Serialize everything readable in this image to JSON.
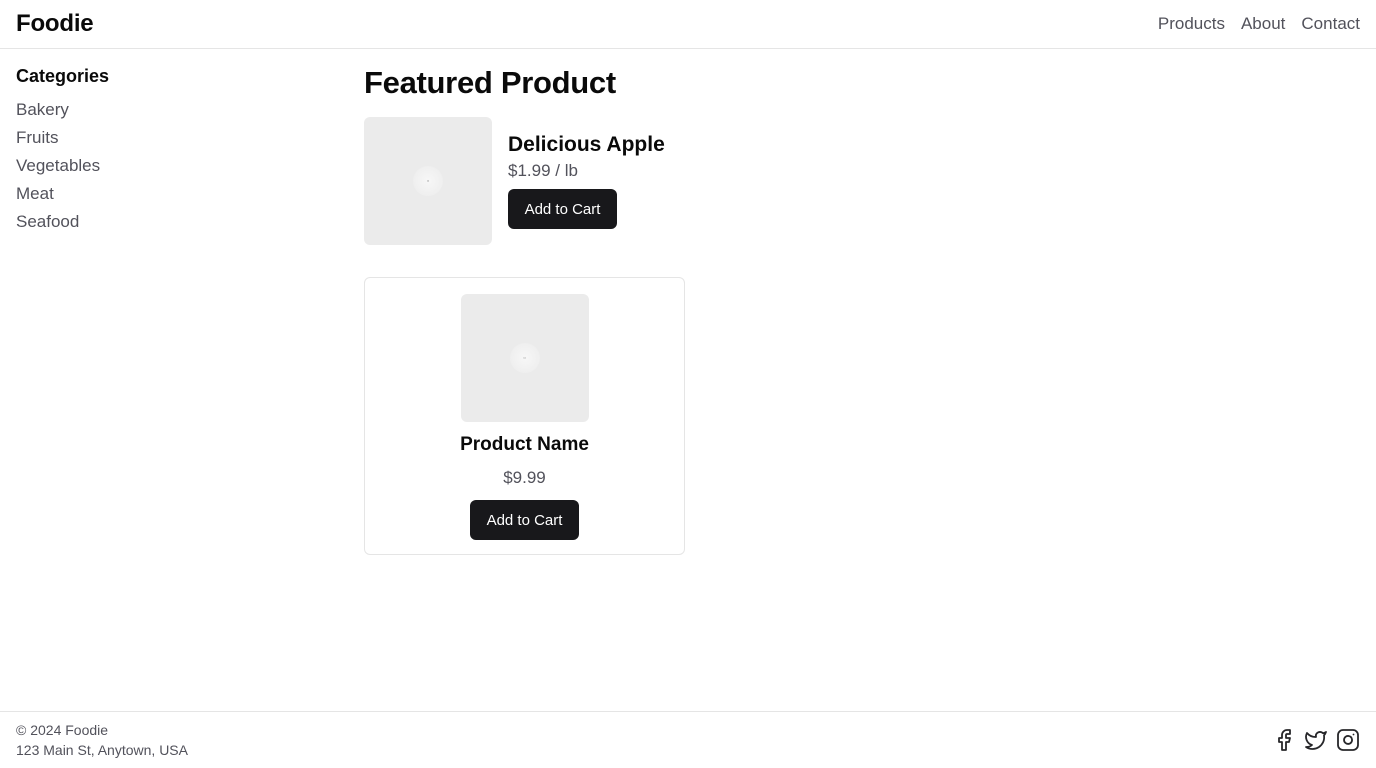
{
  "header": {
    "brand": "Foodie",
    "nav": [
      "Products",
      "About",
      "Contact"
    ]
  },
  "sidebar": {
    "title": "Categories",
    "items": [
      "Bakery",
      "Fruits",
      "Vegetables",
      "Meat",
      "Seafood"
    ]
  },
  "main": {
    "title": "Featured Product",
    "featured": {
      "name": "Delicious Apple",
      "price": "$1.99 / lb",
      "button": "Add to Cart",
      "image_icon": "image-placeholder-icon"
    },
    "card": {
      "name": "Product Name",
      "price": "$9.99",
      "button": "Add to Cart",
      "image_icon": "image-placeholder-icon"
    }
  },
  "footer": {
    "copyright": "© 2024 Foodie",
    "address": "123 Main St, Anytown, USA",
    "social": [
      "facebook-icon",
      "twitter-icon",
      "instagram-icon"
    ]
  },
  "colors": {
    "button_bg": "#18181b",
    "muted_text": "#52525b",
    "border": "#e5e5e5",
    "placeholder_bg": "#ebebeb"
  }
}
